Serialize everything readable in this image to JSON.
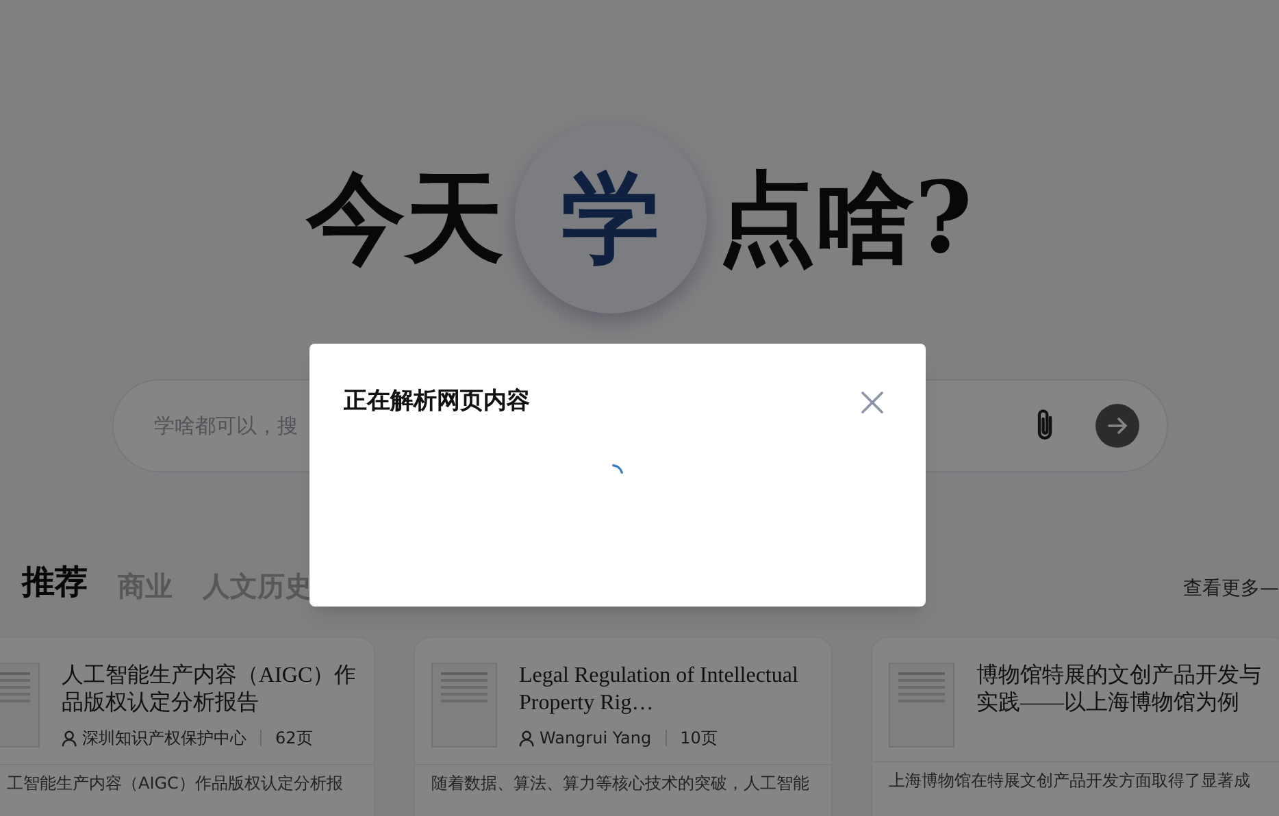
{
  "hero": {
    "before": "今天",
    "highlight": "学",
    "after": "点啥?"
  },
  "search": {
    "placeholder": "学啥都可以，搜"
  },
  "tabs": [
    {
      "label": "推荐",
      "selected": true
    },
    {
      "label": "商业",
      "selected": false
    },
    {
      "label": "人文历史",
      "selected": false
    }
  ],
  "more_link": "查看更多—",
  "cards": [
    {
      "title": "人工智能生产内容（AIGC）作品版权认定分析报告",
      "author": "深圳知识产权保护中心",
      "pages": "62页",
      "excerpt": "工智能生产内容（AIGC）作品版权认定分析报"
    },
    {
      "title": "Legal Regulation of Intellectual Property Rig…",
      "author": "Wangrui Yang",
      "pages": "10页",
      "excerpt": "随着数据、算法、算力等核心技术的突破，人工智能"
    },
    {
      "title": "博物馆特展的文创产品开发与实践——以上海博物馆为例",
      "excerpt": "上海博物馆在特展文创产品开发方面取得了显著成"
    }
  ],
  "dialog": {
    "title": "正在解析网页内容",
    "loading": true
  }
}
